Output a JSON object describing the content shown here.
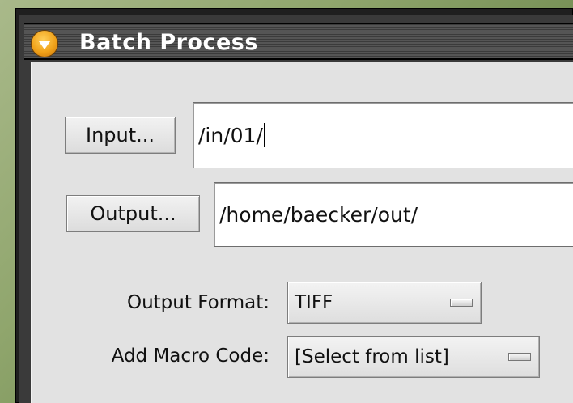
{
  "window": {
    "title": "Batch Process",
    "title_icon": "collapse-triangle-icon"
  },
  "input": {
    "button_label": "Input...",
    "path": "/in/01/"
  },
  "output": {
    "button_label": "Output...",
    "path": "/home/baecker/out/"
  },
  "output_format": {
    "label": "Output Format:",
    "selected": "TIFF"
  },
  "macro_code": {
    "label": "Add Macro Code:",
    "selected": "[Select from list]"
  },
  "colors": {
    "accent": "#f0a21a",
    "titlebar": "#4a4a4a",
    "panel": "#e2e2e2"
  }
}
